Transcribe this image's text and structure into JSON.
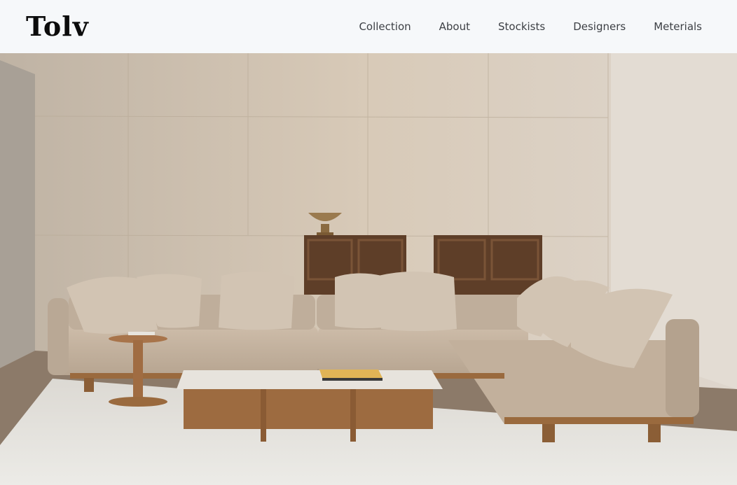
{
  "brand": {
    "logo_text": "Tolv"
  },
  "nav": {
    "items": [
      {
        "label": "Collection",
        "name": "nav-link-collection"
      },
      {
        "label": "About",
        "name": "nav-link-about"
      },
      {
        "label": "Stockists",
        "name": "nav-link-stockists"
      },
      {
        "label": "Designers",
        "name": "nav-link-designers"
      },
      {
        "label": "Meterials",
        "name": "nav-link-meterials"
      }
    ]
  },
  "hero": {
    "colors": {
      "wall": "#d6c8b6",
      "wall_shadow": "#a99c8c",
      "sofa": "#c9b7a4",
      "sofa_dark": "#a99683",
      "wood": "#9a6a3e",
      "dark_wood": "#5b3b25",
      "rug": "#e5e3de",
      "marble": "#ece9e4",
      "book": "#e0b456"
    }
  }
}
